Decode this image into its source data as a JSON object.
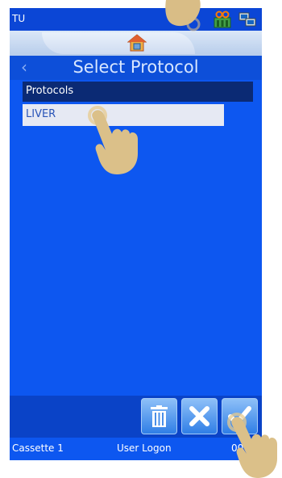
{
  "statusbar": {
    "user": "TU",
    "icons": [
      "pill-container-icon",
      "network-icon"
    ]
  },
  "homebar": {
    "icon": "home-icon"
  },
  "header": {
    "title": "Select Protocol",
    "back_icon": "chevron-left-icon"
  },
  "list": {
    "header": "Protocols",
    "items": [
      {
        "label": "LIVER"
      }
    ]
  },
  "buttons": {
    "delete_icon": "trash-icon",
    "cancel_icon": "close-icon",
    "confirm_icon": "checkmark-icon"
  },
  "footer": {
    "cassette": "Cassette 1",
    "mode": "User Logon",
    "time": "00 5"
  },
  "colors": {
    "background": "#0d57f0",
    "header_bar": "#0b2a74",
    "selected_row": "#e6e9f3",
    "text_accent": "#2a55b8"
  }
}
